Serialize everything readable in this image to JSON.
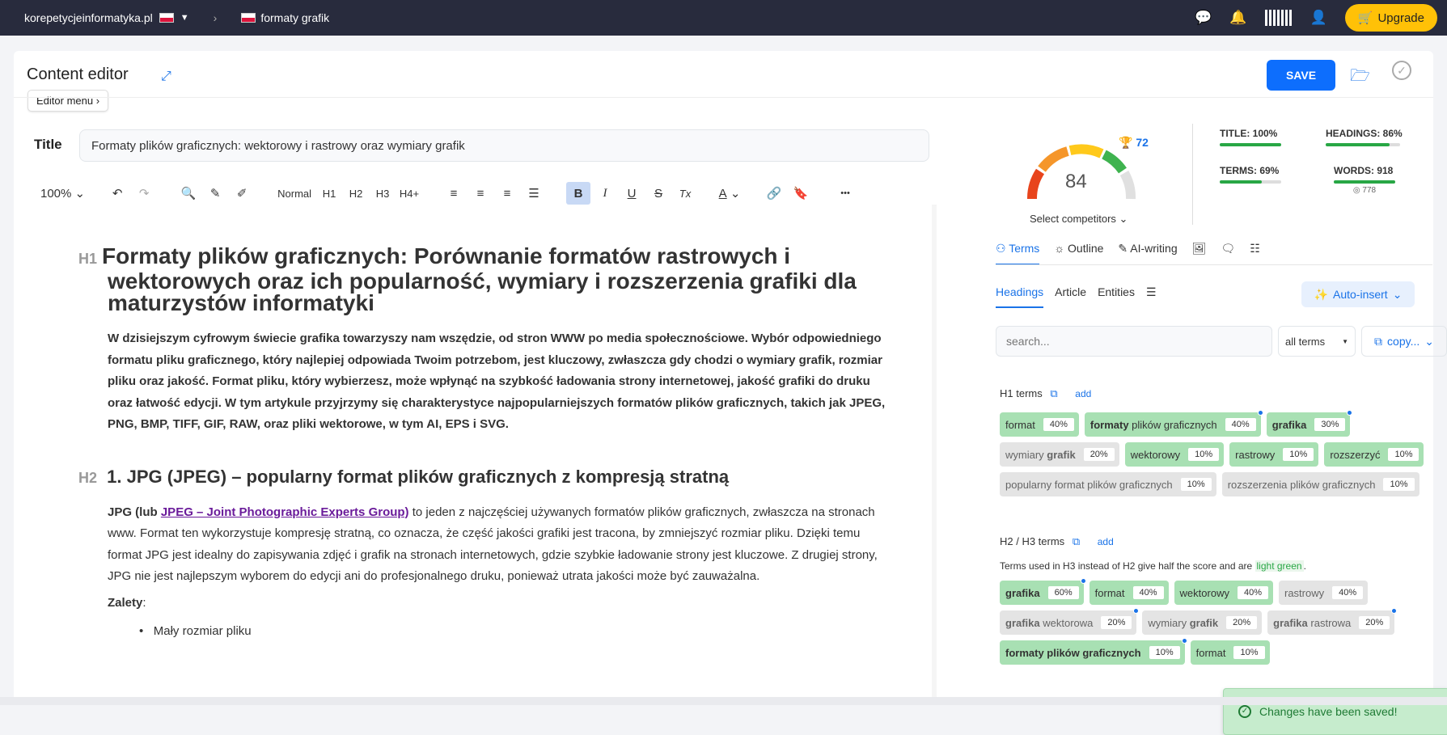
{
  "topbar": {
    "site": "korepetycjeinformatyka.pl",
    "separator": "›",
    "project": "formaty grafik",
    "upgrade": "Upgrade"
  },
  "header": {
    "title": "Content editor",
    "editor_menu": "Editor menu",
    "save": "SAVE"
  },
  "title_field": {
    "label": "Title",
    "value": "Formaty plików graficznych: wektorowy i rastrowy oraz wymiary grafik"
  },
  "toolbar": {
    "zoom": "100%",
    "style_normal": "Normal",
    "h1": "H1",
    "h2": "H2",
    "h3": "H3",
    "h4": "H4+",
    "bold": "B",
    "italic": "I",
    "underline": "U",
    "strike": "S",
    "clear": "Tx",
    "color": "A",
    "more": "•••"
  },
  "content": {
    "h1_tag": "H1",
    "h1": "Formaty plików graficznych: Porównanie formatów rastrowych i wektorowych oraz ich popularność, wymiary i rozszerzenia grafiki dla maturzystów informatyki",
    "intro": "W dzisiejszym cyfrowym świecie grafika towarzyszy nam wszędzie, od stron WWW po media społecznościowe. Wybór odpowiedniego formatu pliku graficznego, który najlepiej odpowiada Twoim potrzebom, jest kluczowy, zwłaszcza gdy chodzi o wymiary grafik, rozmiar pliku oraz jakość. Format pliku, który wybierzesz, może wpłynąć na szybkość ładowania strony internetowej, jakość grafiki do druku oraz łatwość edycji. W tym artykule przyjrzymy się charakterystyce najpopularniejszych formatów plików graficznych, takich jak JPEG, PNG, BMP, TIFF, GIF, RAW, oraz pliki wektorowe, w tym AI, EPS i SVG.",
    "h2_tag": "H2",
    "h2": "1. JPG (JPEG) – popularny format plików graficznych z kompresją stratną",
    "p2_start": "JPG (lub ",
    "p2_link": "JPEG – Joint Photographic Experts Group)",
    "p2_rest": " to jeden z najczęściej używanych formatów plików graficznych, zwłaszcza na stronach www. Format ten wykorzystuje kompresję stratną, co oznacza, że część jakości grafiki jest tracona, by zmniejszyć rozmiar pliku. Dzięki temu format JPG jest idealny do zapisywania zdjęć i grafik na stronach internetowych, gdzie szybkie ładowanie strony jest kluczowe. Z drugiej strony, JPG nie jest najlepszym wyborem do edycji ani do profesjonalnego druku, ponieważ utrata jakości może być zauważalna.",
    "zalety": "Zalety",
    "zalety_colon": ":",
    "li1": "Mały rozmiar pliku"
  },
  "score": {
    "value": "84",
    "trophy": "72",
    "select_competitors": "Select competitors",
    "title_metric": "TITLE: 100%",
    "title_pct": 100,
    "headings_metric": "HEADINGS: 86%",
    "headings_pct": 86,
    "terms_metric": "TERMS: 69%",
    "terms_pct": 69,
    "words_metric": "WORDS: 918",
    "words_pct": 100,
    "words_sub": "778"
  },
  "tabs": [
    "Terms",
    "Outline",
    "AI-writing"
  ],
  "subtabs": [
    "Headings",
    "Article",
    "Entities"
  ],
  "auto_insert": "Auto-insert",
  "search_placeholder": "search...",
  "all_terms": "all terms",
  "copy": "copy...",
  "h1_terms": {
    "label": "H1 terms",
    "add": "add",
    "chips": [
      {
        "b": "",
        "t": "format",
        "p": "40%",
        "c": "g",
        "d": false
      },
      {
        "b": "formaty",
        "t": " plików graficznych",
        "p": "40%",
        "c": "g",
        "d": true
      },
      {
        "b": "grafika",
        "t": "",
        "p": "30%",
        "c": "g",
        "d": true
      },
      {
        "b": "",
        "t": "wymiary ",
        "b2": "grafik",
        "p": "20%",
        "c": "gr",
        "d": false
      },
      {
        "b": "",
        "t": "wektorowy",
        "p": "10%",
        "c": "g",
        "d": false
      },
      {
        "b": "",
        "t": "rastrowy",
        "p": "10%",
        "c": "g",
        "d": false
      },
      {
        "b": "",
        "t": "rozszerzyć",
        "p": "10%",
        "c": "g",
        "d": false
      },
      {
        "b": "",
        "t": "popularny format plików graficznych",
        "p": "10%",
        "c": "gr",
        "d": false
      },
      {
        "b": "",
        "t": "rozszerzenia plików graficznych",
        "p": "10%",
        "c": "gr",
        "d": false
      }
    ]
  },
  "h23_terms": {
    "label": "H2 / H3 terms",
    "add": "add",
    "note_start": "Terms used in H3 instead of H2 give half the score and are ",
    "note_green": "light green",
    "note_end": ".",
    "chips": [
      {
        "b": "grafika",
        "t": "",
        "p": "60%",
        "c": "g",
        "d": true
      },
      {
        "b": "",
        "t": "format",
        "p": "40%",
        "c": "g",
        "d": false
      },
      {
        "b": "",
        "t": "wektorowy",
        "p": "40%",
        "c": "g",
        "d": false
      },
      {
        "b": "",
        "t": "rastrowy",
        "p": "40%",
        "c": "gr",
        "d": false
      },
      {
        "b": "grafika",
        "t": " wektorowa",
        "p": "20%",
        "c": "gr",
        "d": true
      },
      {
        "b": "",
        "t": "wymiary ",
        "b2": "grafik",
        "p": "20%",
        "c": "gr",
        "d": false
      },
      {
        "b": "grafika",
        "t": " rastrowa",
        "p": "20%",
        "c": "gr",
        "d": true
      },
      {
        "b": "formaty plików graficznych",
        "t": "",
        "p": "10%",
        "c": "g",
        "d": true
      },
      {
        "b": "",
        "t": "format",
        "p": "10%",
        "c": "g",
        "d": false
      }
    ]
  },
  "toast": "Changes have been saved!"
}
